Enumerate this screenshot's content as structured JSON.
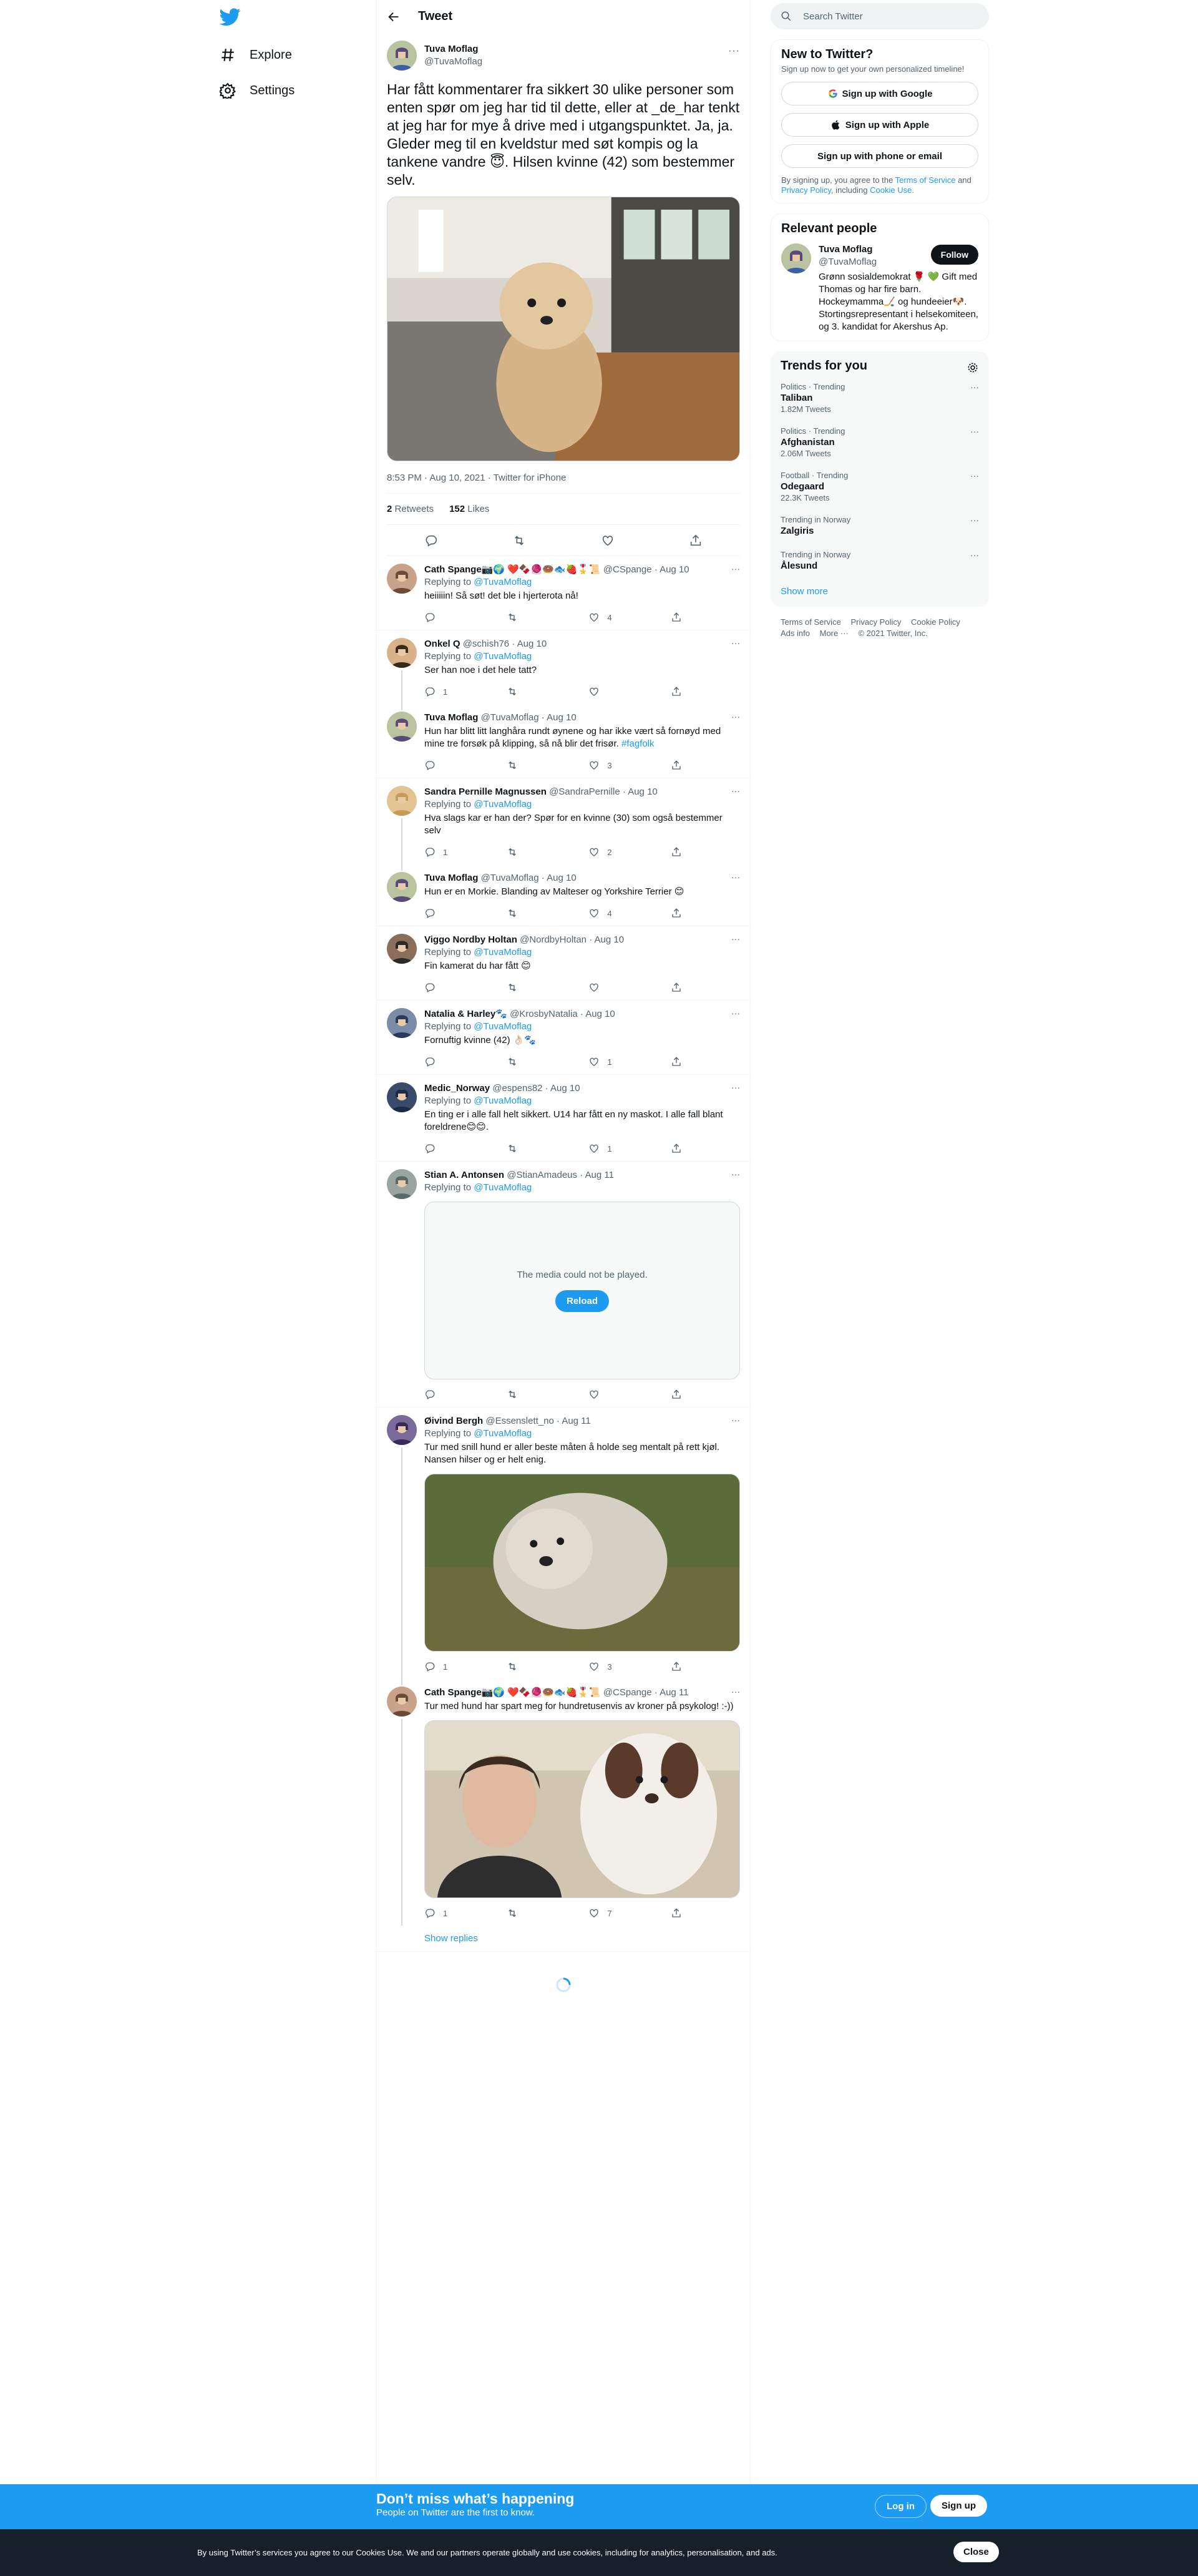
{
  "nav": {
    "explore": "Explore",
    "settings": "Settings"
  },
  "header": {
    "title": "Tweet"
  },
  "focal": {
    "name": "Tuva Moflag",
    "handle": "@TuvaMoflag",
    "text": "Har fått kommentarer fra sikkert 30 ulike personer som enten spør om jeg har tid til dette, eller at _de_har tenkt at jeg har for mye å drive med i utgangspunktet. Ja, ja. Gleder meg til en kveldstur med søt kompis og la tankene vandre 😇. Hilsen kvinne (42) som bestemmer selv.",
    "meta": "8:53 PM · Aug 10, 2021 · Twitter for iPhone",
    "retweets": "2",
    "retweets_label": "Retweets",
    "likes": "152",
    "likes_label": "Likes"
  },
  "replies": [
    {
      "name": "Cath Spange📷🌍 ❤️🍫🧶🍩🐟🍓🎖️📜",
      "handle": "@CSpange",
      "date": "· Aug 10",
      "to_label": "Replying to",
      "to": "@TuvaMoflag",
      "text": "heiiiiin! Så søt! det ble i hjerterota nå!",
      "reply": "",
      "rt": "",
      "like": "4"
    },
    {
      "name": "Onkel Q",
      "handle": "@schish76",
      "date": "· Aug 10",
      "to_label": "Replying to",
      "to": "@TuvaMoflag",
      "text": "Ser han noe i det hele tatt?",
      "reply": "1",
      "rt": "",
      "like": ""
    },
    {
      "name": "Tuva Moflag",
      "handle": "@TuvaMoflag",
      "date": "· Aug 10",
      "text": "Hun har blitt litt langhåra rundt øynene og har ikke vært så fornøyd med mine tre forsøk på klipping, så nå blir det frisør.",
      "link": "#fagfolk",
      "reply": "",
      "rt": "",
      "like": "3"
    },
    {
      "name": "Sandra Pernille Magnussen",
      "handle": "@SandraPernille",
      "date": "· Aug 10",
      "to_label": "Replying to",
      "to": "@TuvaMoflag",
      "text": "Hva slags kar er han der? Spør for en kvinne (30) som også bestemmer selv",
      "reply": "1",
      "rt": "",
      "like": "2"
    },
    {
      "name": "Tuva Moflag",
      "handle": "@TuvaMoflag",
      "date": "· Aug 10",
      "text": "Hun er en Morkie. Blanding av Malteser og Yorkshire Terrier 😊",
      "reply": "",
      "rt": "",
      "like": "4"
    },
    {
      "name": "Viggo Nordby Holtan",
      "handle": "@NordbyHoltan",
      "date": "· Aug 10",
      "to_label": "Replying to",
      "to": "@TuvaMoflag",
      "text": "Fin kamerat du har fått 😊",
      "reply": "",
      "rt": "",
      "like": ""
    },
    {
      "name": "Natalia & Harley🐾",
      "handle": "@KrosbyNatalia",
      "date": "· Aug 10",
      "to_label": "Replying to",
      "to": "@TuvaMoflag",
      "text": "Fornuftig kvinne (42) 👌🏻🐾",
      "reply": "",
      "rt": "",
      "like": "1"
    },
    {
      "name": "Medic_Norway",
      "handle": "@espens82",
      "date": "· Aug 10",
      "to_label": "Replying to",
      "to": "@TuvaMoflag",
      "text": "En ting er i alle fall helt sikkert. U14 har fått en ny maskot. I alle fall blant foreldrene😊😊.",
      "reply": "",
      "rt": "",
      "like": "1"
    },
    {
      "name": "Stian A. Antonsen",
      "handle": "@StianAmadeus",
      "date": "· Aug 11",
      "to_label": "Replying to",
      "to": "@TuvaMoflag",
      "media_error": "The media could not be played.",
      "reload": "Reload",
      "reply": "",
      "rt": "",
      "like": ""
    },
    {
      "name": "Øivind Bergh",
      "handle": "@Essenslett_no",
      "date": "· Aug 11",
      "to_label": "Replying to",
      "to": "@TuvaMoflag",
      "text": "Tur med snill hund er aller beste måten å holde seg mentalt på rett kjøl. Nansen hilser og er helt enig.",
      "reply": "1",
      "rt": "",
      "like": "3"
    },
    {
      "name": "Cath Spange📷🌍 ❤️🍫🧶🍩🐟🍓🎖️📜",
      "handle": "@CSpange",
      "date": "· Aug 11",
      "text": "Tur med hund har spart meg for hundretusenvis av kroner på psykolog! :-))",
      "reply": "1",
      "rt": "",
      "like": "7"
    }
  ],
  "show_replies": "Show replies",
  "search": {
    "placeholder": "Search Twitter"
  },
  "new_to": {
    "title": "New to Twitter?",
    "sub": "Sign up now to get your own personalized timeline!",
    "google": "Sign up with Google",
    "apple": "Sign up with Apple",
    "phone": "Sign up with phone or email",
    "legal1": "By signing up, you agree to the",
    "tos": "Terms of Service",
    "and": "and",
    "privacy": "Privacy Policy",
    "legal2": ", including",
    "cookie": "Cookie Use."
  },
  "relevant": {
    "title": "Relevant people",
    "name": "Tuva Moflag",
    "handle": "@TuvaMoflag",
    "follow": "Follow",
    "bio": "Grønn sosialdemokrat 🌹 💚 Gift med Thomas og har fire barn. Hockeymamma🏒 og hundeeier🐶. Stortingsrepresentant i helsekomiteen, og 3. kandidat for Akershus Ap."
  },
  "trends": {
    "title": "Trends for you",
    "items": [
      {
        "cat": "Politics · Trending",
        "name": "Taliban",
        "count": "1.82M Tweets"
      },
      {
        "cat": "Politics · Trending",
        "name": "Afghanistan",
        "count": "2.06M Tweets"
      },
      {
        "cat": "Football · Trending",
        "name": "Odegaard",
        "count": "22.3K Tweets"
      },
      {
        "cat": "Trending in Norway",
        "name": "Zalgiris",
        "count": ""
      },
      {
        "cat": "Trending in Norway",
        "name": "Ålesund",
        "count": ""
      }
    ],
    "show_more": "Show more"
  },
  "footer": {
    "tos": "Terms of Service",
    "privacy": "Privacy Policy",
    "cookie": "Cookie Policy",
    "ads": "Ads info",
    "more": "More ···",
    "copy": "© 2021 Twitter, Inc."
  },
  "banner": {
    "title": "Don’t miss what’s happening",
    "sub": "People on Twitter are the first to know.",
    "login": "Log in",
    "signup": "Sign up"
  },
  "cookie": {
    "text": "By using Twitter’s services you agree to our Cookies Use. We and our partners operate globally and use cookies, including for analytics, personalisation, and ads.",
    "close": "Close"
  },
  "colors": {
    "accent": "#1d9bf0",
    "text": "#0f1419",
    "muted": "#536471"
  }
}
